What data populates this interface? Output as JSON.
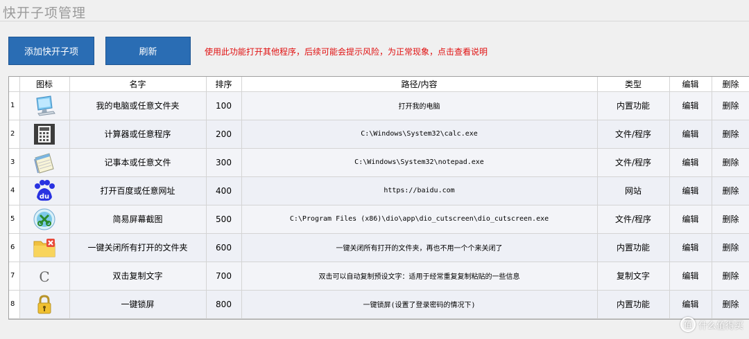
{
  "window": {
    "title": "快开子项管理"
  },
  "toolbar": {
    "add_label": "添加快开子项",
    "refresh_label": "刷新",
    "notice": "使用此功能打开其他程序，后续可能会提示风险，为正常现象，点击查看说明"
  },
  "table": {
    "columns": [
      "图标",
      "名字",
      "排序",
      "路径/内容",
      "类型",
      "编辑",
      "删除"
    ],
    "rows": [
      {
        "num": "1",
        "icon": "computer-icon",
        "name": "我的电脑或任意文件夹",
        "order": "100",
        "path": "打开我的电脑",
        "type": "内置功能",
        "edit": "编辑",
        "delete": "删除"
      },
      {
        "num": "2",
        "icon": "calculator-icon",
        "name": "计算器或任意程序",
        "order": "200",
        "path": "C:\\Windows\\System32\\calc.exe",
        "type": "文件/程序",
        "edit": "编辑",
        "delete": "删除"
      },
      {
        "num": "3",
        "icon": "notepad-icon",
        "name": "记事本或任意文件",
        "order": "300",
        "path": "C:\\Windows\\System32\\notepad.exe",
        "type": "文件/程序",
        "edit": "编辑",
        "delete": "删除"
      },
      {
        "num": "4",
        "icon": "baidu-icon",
        "name": "打开百度或任意网址",
        "order": "400",
        "path": "https://baidu.com",
        "type": "网站",
        "edit": "编辑",
        "delete": "删除"
      },
      {
        "num": "5",
        "icon": "screenshot-icon",
        "name": "简易屏幕截图",
        "order": "500",
        "path": "C:\\Program Files (x86)\\dio\\app\\dio_cutscreen\\dio_cutscreen.exe",
        "type": "文件/程序",
        "edit": "编辑",
        "delete": "删除"
      },
      {
        "num": "6",
        "icon": "folder-close-icon",
        "name": "一键关闭所有打开的文件夹",
        "order": "600",
        "path": "一键关闭所有打开的文件夹，再也不用一个个来关闭了",
        "type": "内置功能",
        "edit": "编辑",
        "delete": "删除"
      },
      {
        "num": "7",
        "icon": "copy-text-icon",
        "name": "双击复制文字",
        "order": "700",
        "path": "双击可以自动复制预设文字：适用于经常重复复制粘贴的一些信息",
        "type": "复制文字",
        "edit": "编辑",
        "delete": "删除"
      },
      {
        "num": "8",
        "icon": "lock-icon",
        "name": "一键锁屏",
        "order": "800",
        "path": "一键锁屏(设置了登录密码的情况下)",
        "type": "内置功能",
        "edit": "编辑",
        "delete": "删除"
      }
    ]
  },
  "watermark": {
    "text": "什么值得买",
    "badge": "值"
  },
  "icon_glyphs": {
    "copy-text-icon": "C",
    "baidu-icon": "du"
  }
}
